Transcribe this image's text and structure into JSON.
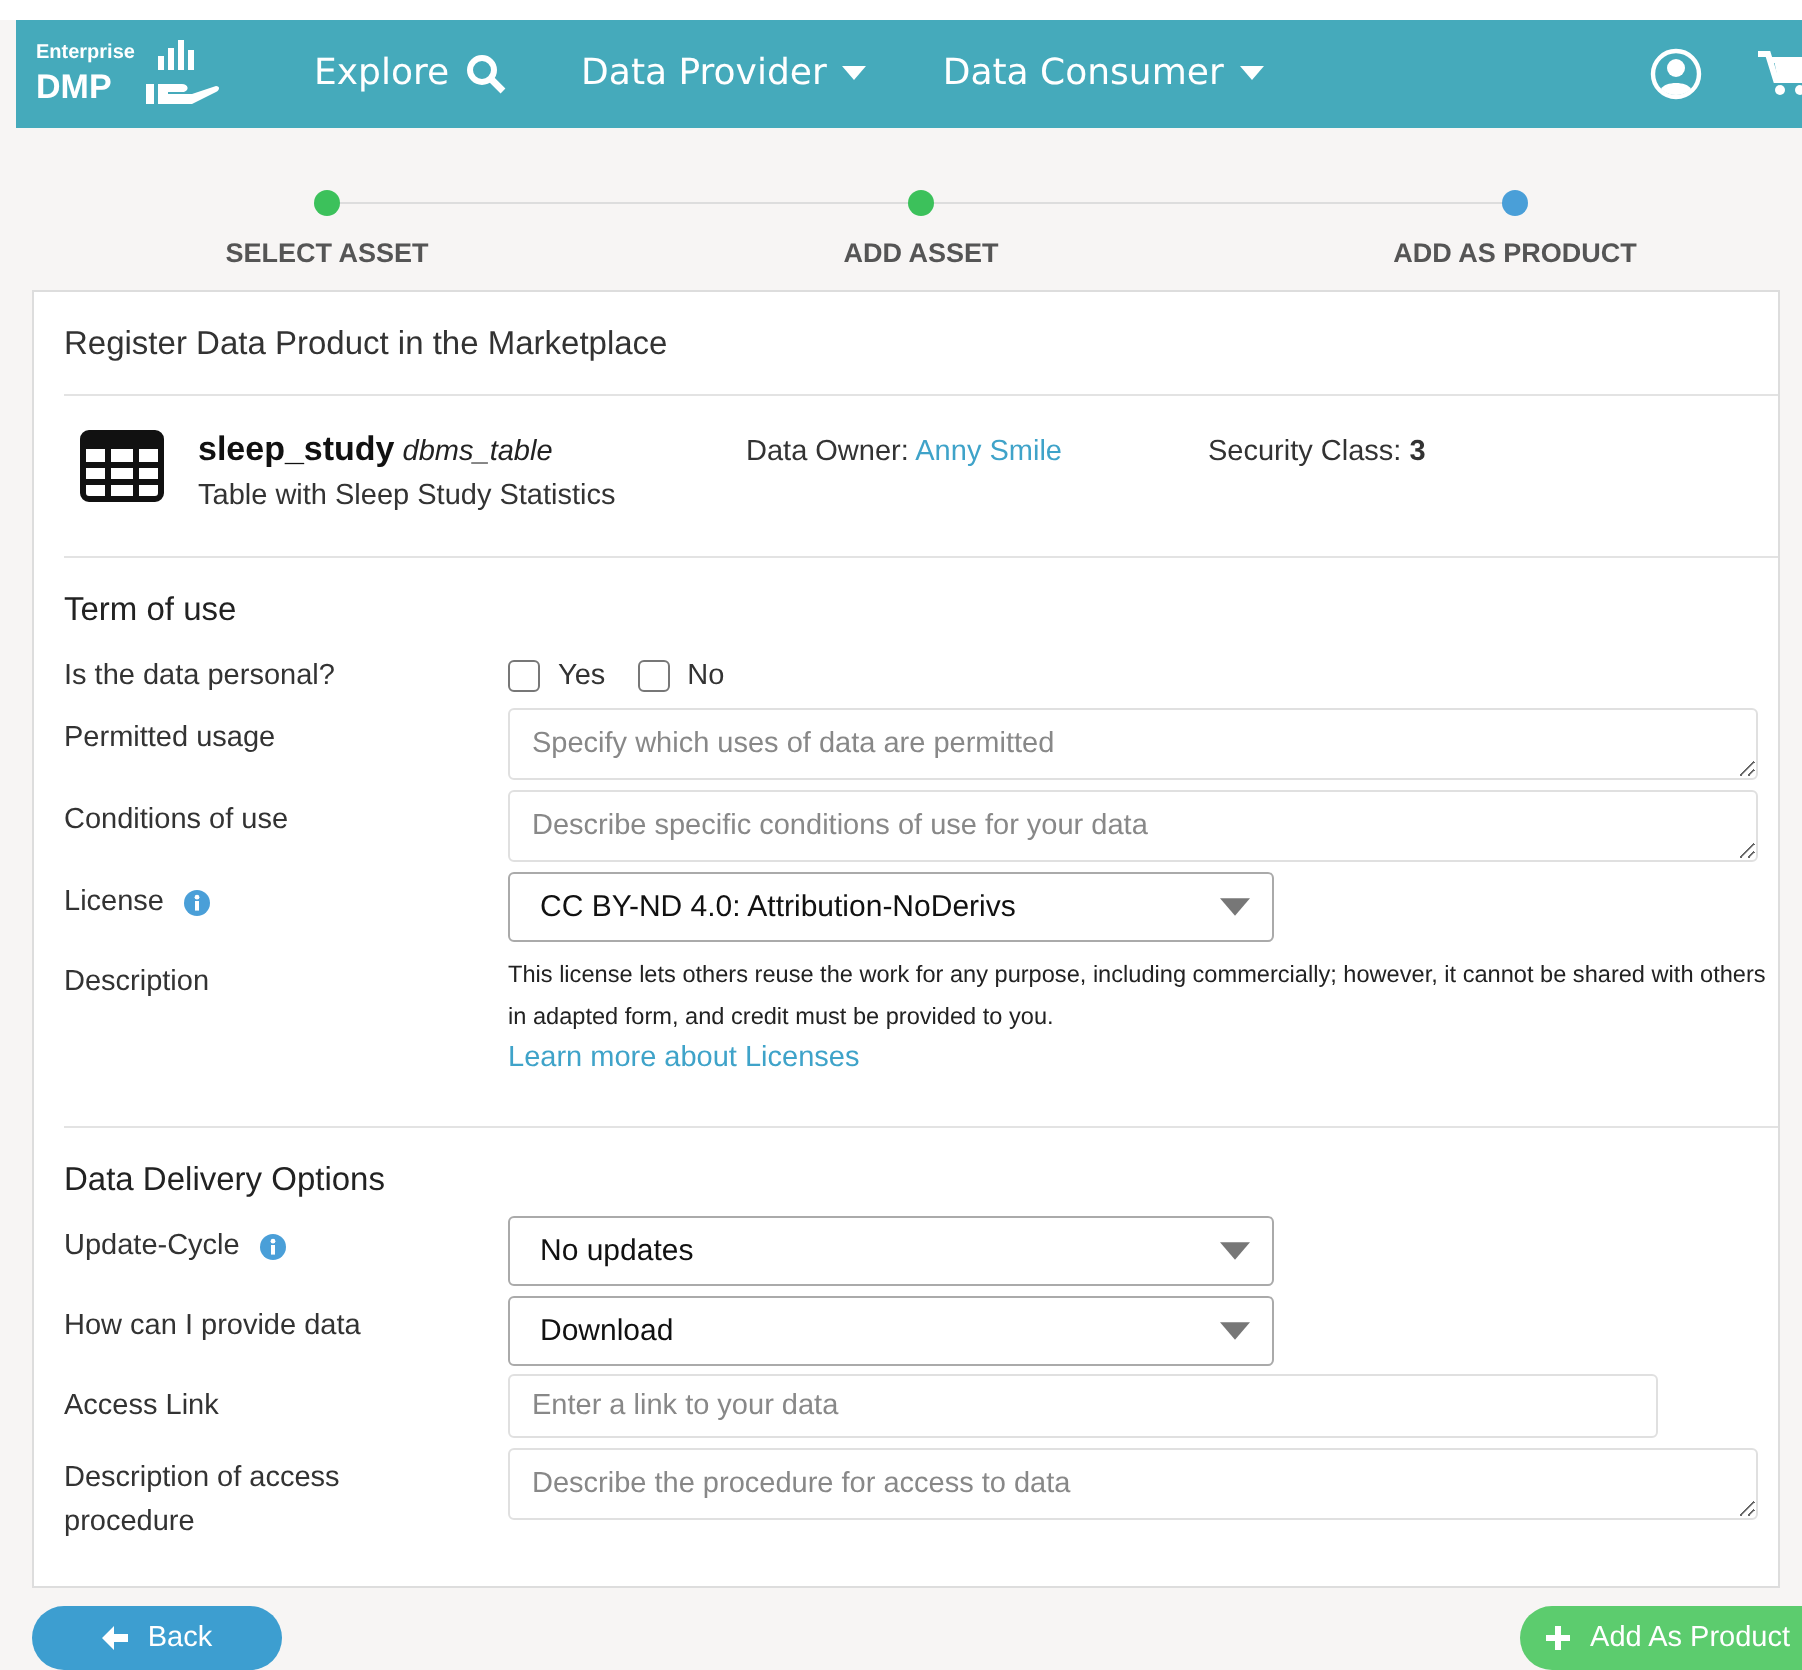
{
  "nav": {
    "logo_top": "Enterprise",
    "logo_bottom": "DMP",
    "items": [
      {
        "label": "Explore",
        "kind": "search"
      },
      {
        "label": "Data Provider",
        "kind": "dropdown"
      },
      {
        "label": "Data Consumer",
        "kind": "dropdown"
      }
    ]
  },
  "steps": [
    {
      "label": "SELECT ASSET",
      "done": true
    },
    {
      "label": "ADD ASSET",
      "done": true
    },
    {
      "label": "ADD AS PRODUCT",
      "done": false
    }
  ],
  "card": {
    "title": "Register Data Product in the Marketplace",
    "asset": {
      "name": "sleep_study",
      "type": "dbms_table",
      "subtitle": "Table with Sleep Study Statistics",
      "owner_label": "Data Owner:",
      "owner": "Anny Smile",
      "security_label": "Security Class:",
      "security": "3"
    },
    "sections": [
      {
        "heading": "Term of use",
        "rows": [
          {
            "kind": "checkboxes",
            "label": "Is the data personal?",
            "options": [
              {
                "label": "Yes",
                "checked": false
              },
              {
                "label": "No",
                "checked": false
              }
            ]
          },
          {
            "kind": "textarea",
            "label": "Permitted usage",
            "placeholder": "Specify which uses of data are permitted"
          },
          {
            "kind": "textarea",
            "label": "Conditions of use",
            "placeholder": "Describe specific conditions of use for your data"
          },
          {
            "kind": "select",
            "label": "License",
            "info": true,
            "value": "CC BY-ND 4.0: Attribution-NoDerivs"
          },
          {
            "kind": "description",
            "label": "Description",
            "text": "This license lets others reuse the work for any purpose, including commercially; however, it cannot be shared with others in adapted form, and credit must be provided to you.",
            "link": "Learn more about Licenses"
          }
        ]
      },
      {
        "heading": "Data Delivery Options",
        "rows": [
          {
            "kind": "select",
            "label": "Update-Cycle",
            "info": true,
            "value": "No updates"
          },
          {
            "kind": "select",
            "label": "How can I provide data",
            "value": "Download"
          },
          {
            "kind": "input",
            "label": "Access Link",
            "placeholder": "Enter a link to your data"
          },
          {
            "kind": "textarea",
            "label": "Description of access procedure",
            "placeholder": "Describe the procedure for access to data"
          }
        ]
      }
    ]
  },
  "buttons": [
    {
      "label": "Back",
      "kind": "back"
    },
    {
      "label": "Add As Product",
      "kind": "add"
    }
  ]
}
